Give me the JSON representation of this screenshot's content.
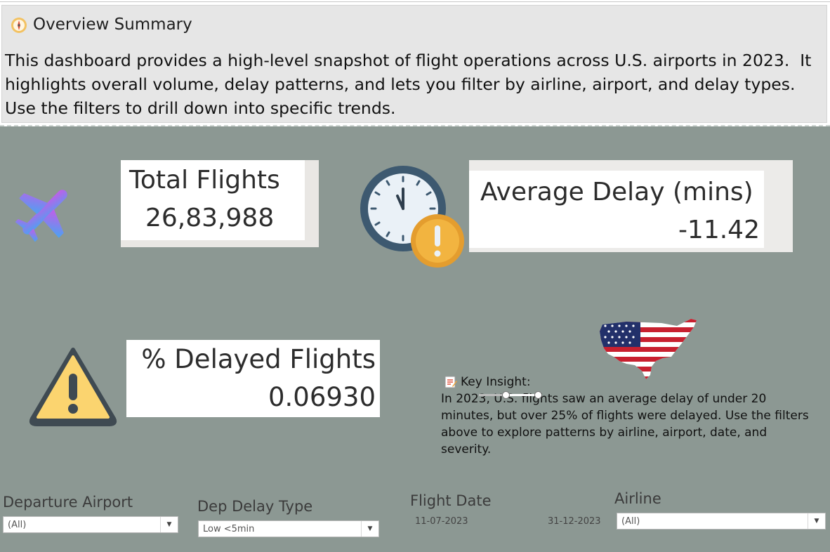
{
  "header": {
    "title": "Overview Summary",
    "description": "This dashboard provides a high-level snapshot of flight operations across U.S. airports in 2023.  It highlights overall volume, delay patterns, and lets you filter by airline, airport, and delay types.  Use the filters to drill down into specific trends."
  },
  "kpis": {
    "total_flights": {
      "label": "Total Flights",
      "value": "26,83,988",
      "icon": "airplane-icon"
    },
    "average_delay": {
      "label": "Average Delay (mins)",
      "value": "-11.42",
      "icon": "clock-alert-icon"
    },
    "pct_delayed": {
      "label": "% Delayed Flights",
      "value": "0.06930",
      "icon": "warning-icon"
    }
  },
  "insight": {
    "title": "Key Insight:",
    "text": "In 2023, U.S. flights saw an average delay of under 20 minutes, but over 25% of flights were delayed. Use the filters above to explore patterns by airline, airport, date, and severity.",
    "icon": "usa-flag-map-icon"
  },
  "filters": {
    "departure_airport": {
      "label": "Departure Airport",
      "value": "(All)"
    },
    "dep_delay_type": {
      "label": "Dep Delay Type",
      "value": "Low <5min"
    },
    "flight_date": {
      "label": "Flight Date",
      "start": "11-07-2023",
      "end": "31-12-2023",
      "range_fraction": [
        0.45,
        1.0
      ]
    },
    "airline": {
      "label": "Airline",
      "value": "(All)"
    }
  },
  "colors": {
    "background": "#8c9893",
    "header_bg": "#e6e6e6",
    "card_bg": "#ffffff"
  }
}
